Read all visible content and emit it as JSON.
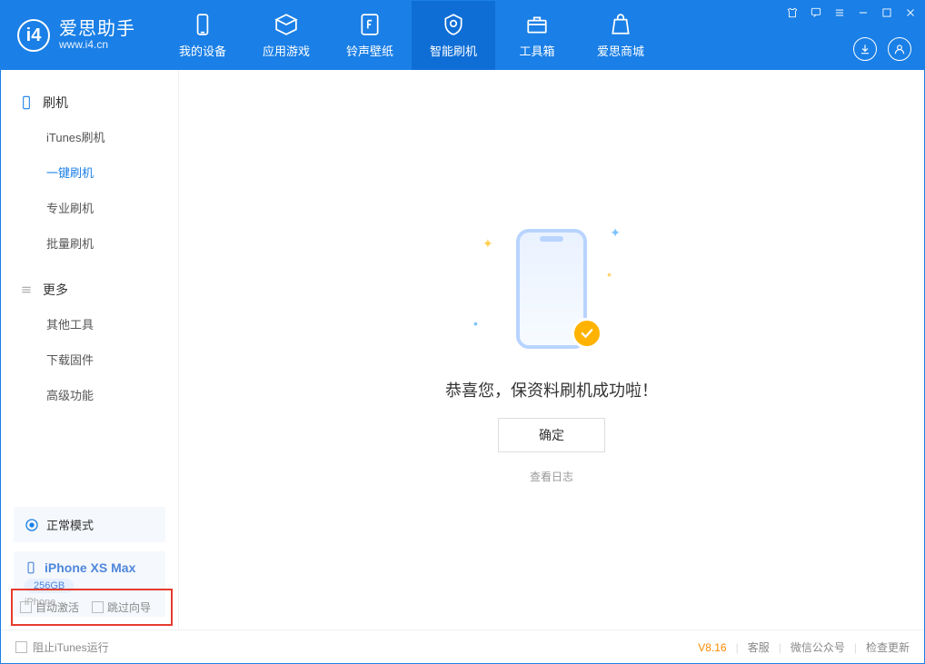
{
  "app": {
    "name": "爱思助手",
    "url": "www.i4.cn"
  },
  "tabs": [
    {
      "label": "我的设备"
    },
    {
      "label": "应用游戏"
    },
    {
      "label": "铃声壁纸"
    },
    {
      "label": "智能刷机"
    },
    {
      "label": "工具箱"
    },
    {
      "label": "爱思商城"
    }
  ],
  "sidebar": {
    "group1": {
      "title": "刷机",
      "items": [
        "iTunes刷机",
        "一键刷机",
        "专业刷机",
        "批量刷机"
      ]
    },
    "group2": {
      "title": "更多",
      "items": [
        "其他工具",
        "下载固件",
        "高级功能"
      ]
    }
  },
  "device": {
    "mode": "正常模式",
    "name": "iPhone XS Max",
    "storage": "256GB",
    "type": "iPhone"
  },
  "options": {
    "autoActivate": "自动激活",
    "skipGuide": "跳过向导"
  },
  "main": {
    "successTitle": "恭喜您，保资料刷机成功啦！",
    "okButton": "确定",
    "viewLog": "查看日志"
  },
  "footer": {
    "blockItunes": "阻止iTunes运行",
    "version": "V8.16",
    "service": "客服",
    "wechat": "微信公众号",
    "update": "检查更新"
  }
}
